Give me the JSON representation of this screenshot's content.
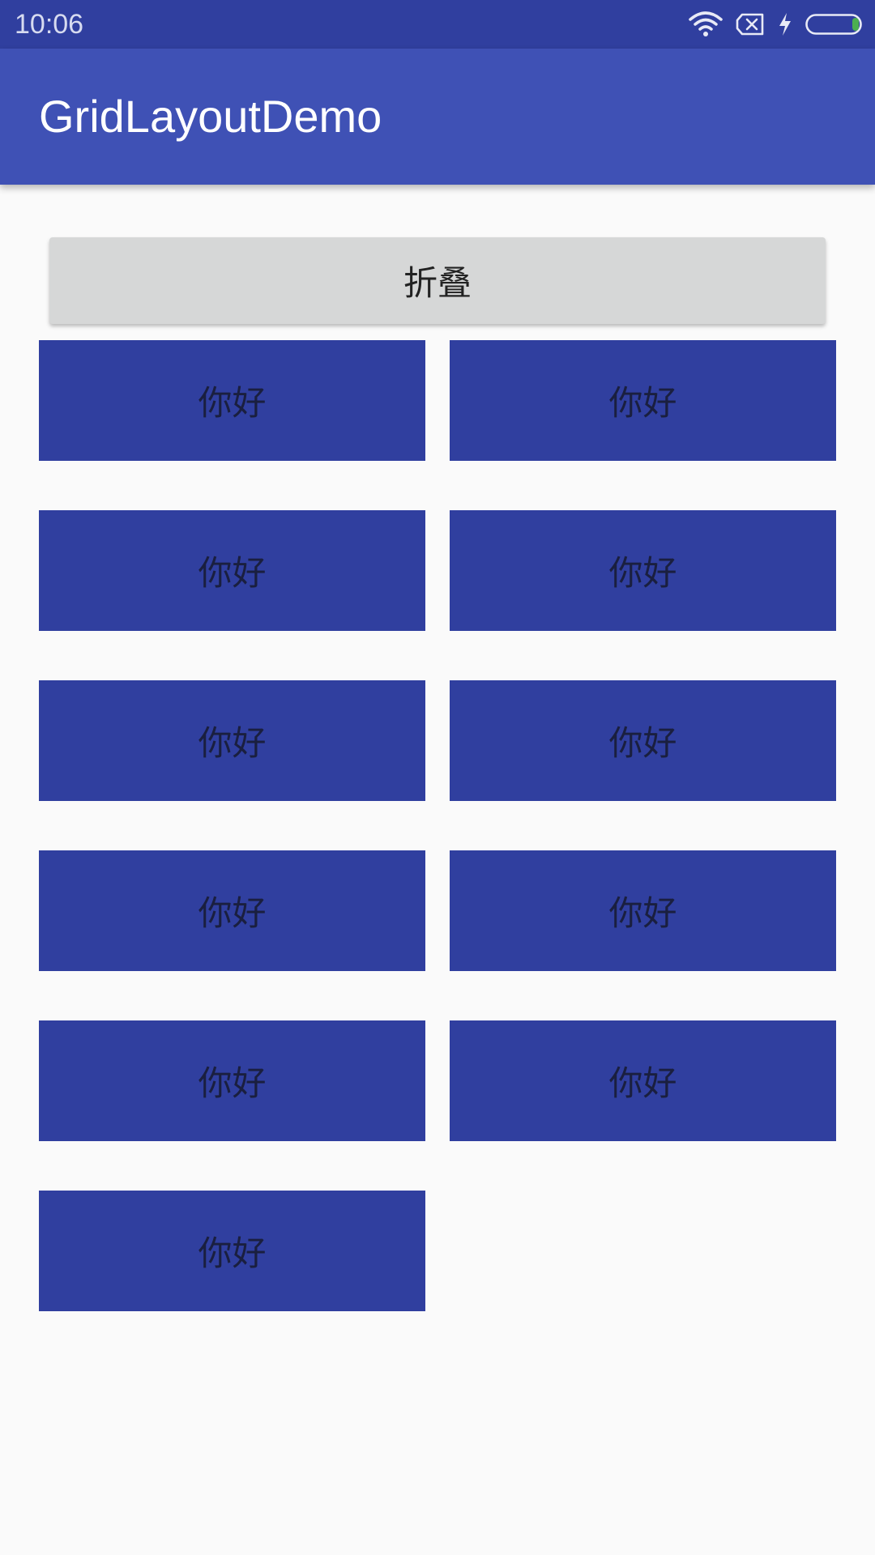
{
  "status_bar": {
    "time": "10:06",
    "icons": [
      "wifi-icon",
      "sim-card-x-icon",
      "charging-bolt-icon",
      "battery-icon"
    ],
    "battery_level": 0.05
  },
  "app_bar": {
    "title": "GridLayoutDemo",
    "color": "#3f51b5"
  },
  "fold_button": {
    "label": "折叠"
  },
  "grid": {
    "cell_color": "#303f9f",
    "items": [
      {
        "label": "你好"
      },
      {
        "label": "你好"
      },
      {
        "label": "你好"
      },
      {
        "label": "你好"
      },
      {
        "label": "你好"
      },
      {
        "label": "你好"
      },
      {
        "label": "你好"
      },
      {
        "label": "你好"
      },
      {
        "label": "你好"
      },
      {
        "label": "你好"
      },
      {
        "label": "你好"
      }
    ]
  }
}
